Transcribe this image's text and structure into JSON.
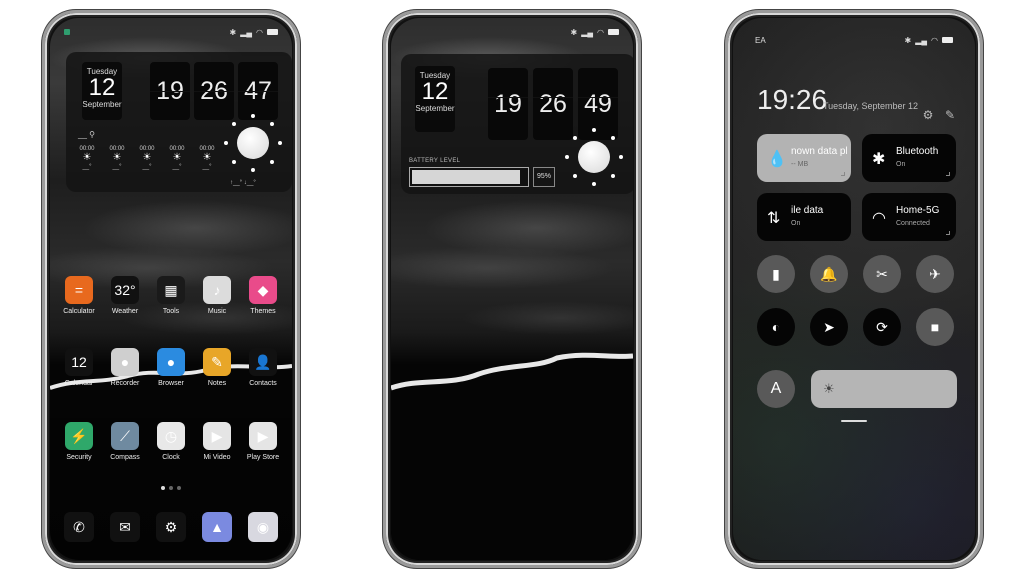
{
  "phone1": {
    "status": {
      "notification": "green-square",
      "icons": [
        "bluetooth-icon",
        "signal-icon",
        "wifi-icon",
        "battery-icon"
      ]
    },
    "widget": {
      "day_of_week": "Tuesday",
      "day": "12",
      "month": "September",
      "hour": "19",
      "minute": "26",
      "second": "47",
      "location": "__",
      "forecast": [
        {
          "time": "00:00",
          "temp": "__°"
        },
        {
          "time": "00:00",
          "temp": "__°"
        },
        {
          "time": "00:00",
          "temp": "__°"
        },
        {
          "time": "00:00",
          "temp": "__°"
        },
        {
          "time": "00:00",
          "temp": "__°"
        }
      ],
      "hi_lo": "↑__° ↓__°"
    },
    "apps_row1": [
      {
        "label": "Calculator",
        "icon": "=",
        "color": "#e8691e"
      },
      {
        "label": "Weather",
        "icon": "32°",
        "color": "#111111"
      },
      {
        "label": "Tools",
        "icon": "▦",
        "color": "#1a1a1a"
      },
      {
        "label": "Music",
        "icon": "♪",
        "color": "#dcdcdc"
      },
      {
        "label": "Themes",
        "icon": "◆",
        "color": "#e94b8a"
      }
    ],
    "apps_row2": [
      {
        "label": "Calendar",
        "icon": "12",
        "color": "#111111"
      },
      {
        "label": "Recorder",
        "icon": "●",
        "color": "#cfcfcf"
      },
      {
        "label": "Browser",
        "icon": "●",
        "color": "#2b8be0"
      },
      {
        "label": "Notes",
        "icon": "✎",
        "color": "#e8a628"
      },
      {
        "label": "Contacts",
        "icon": "👤",
        "color": "#111111"
      }
    ],
    "apps_row3": [
      {
        "label": "Security",
        "icon": "⚡",
        "color": "#2fa86a"
      },
      {
        "label": "Compass",
        "icon": "⟋",
        "color": "#6f8aa0"
      },
      {
        "label": "Clock",
        "icon": "◷",
        "color": "#e8e8e8"
      },
      {
        "label": "Mi Video",
        "icon": "▶",
        "color": "#e5e5e5"
      },
      {
        "label": "Play Store",
        "icon": "▶",
        "color": "#e5e5e5"
      }
    ],
    "page_dots": 3,
    "active_page": 1,
    "dock": [
      {
        "label": "Phone",
        "icon": "✆",
        "color": "#111111"
      },
      {
        "label": "Messages",
        "icon": "✉",
        "color": "#111111"
      },
      {
        "label": "Settings",
        "icon": "⚙",
        "color": "#111111"
      },
      {
        "label": "Gallery",
        "icon": "▲",
        "color": "#7b8ae0"
      },
      {
        "label": "Camera",
        "icon": "◉",
        "color": "#d8d8e0"
      }
    ]
  },
  "phone2": {
    "status": {
      "icons": [
        "bluetooth-icon",
        "signal-icon",
        "wifi-icon",
        "battery-icon"
      ]
    },
    "widget": {
      "day_of_week": "Tuesday",
      "day": "12",
      "month": "September",
      "hour": "19",
      "minute": "26",
      "second": "49",
      "battery_label": "BATTERY LEVEL",
      "battery_percent_text": "95%",
      "battery_level": 0.95
    }
  },
  "phone3": {
    "status": {
      "carrier": "EA",
      "icons": [
        "bluetooth-icon",
        "signal-icon",
        "wifi-icon",
        "battery-icon"
      ]
    },
    "time": "19:26",
    "date": "Tuesday, September 12",
    "tiles": [
      {
        "title": "nown data pla",
        "sub": "-- MB",
        "icon": "💧",
        "state": "on"
      },
      {
        "title": "Bluetooth",
        "sub": "On",
        "icon": "✱",
        "state": "off"
      },
      {
        "title": "ile data",
        "sub": "On",
        "icon": "⇅",
        "state": "off"
      },
      {
        "title": "Home-5G",
        "sub": "Connected",
        "icon": "◠",
        "state": "off"
      }
    ],
    "toggles_row1": [
      {
        "name": "flashlight",
        "icon": "▮"
      },
      {
        "name": "silent",
        "icon": "🔔"
      },
      {
        "name": "screenshot",
        "icon": "✂"
      },
      {
        "name": "airplane",
        "icon": "✈"
      }
    ],
    "toggles_row2": [
      {
        "name": "dark-mode",
        "icon": "◐"
      },
      {
        "name": "location",
        "icon": "➤"
      },
      {
        "name": "rotation-lock",
        "icon": "⟳"
      },
      {
        "name": "screen-record",
        "icon": "■"
      }
    ],
    "auto_brightness_label": "A",
    "brightness_level": 1.0
  }
}
